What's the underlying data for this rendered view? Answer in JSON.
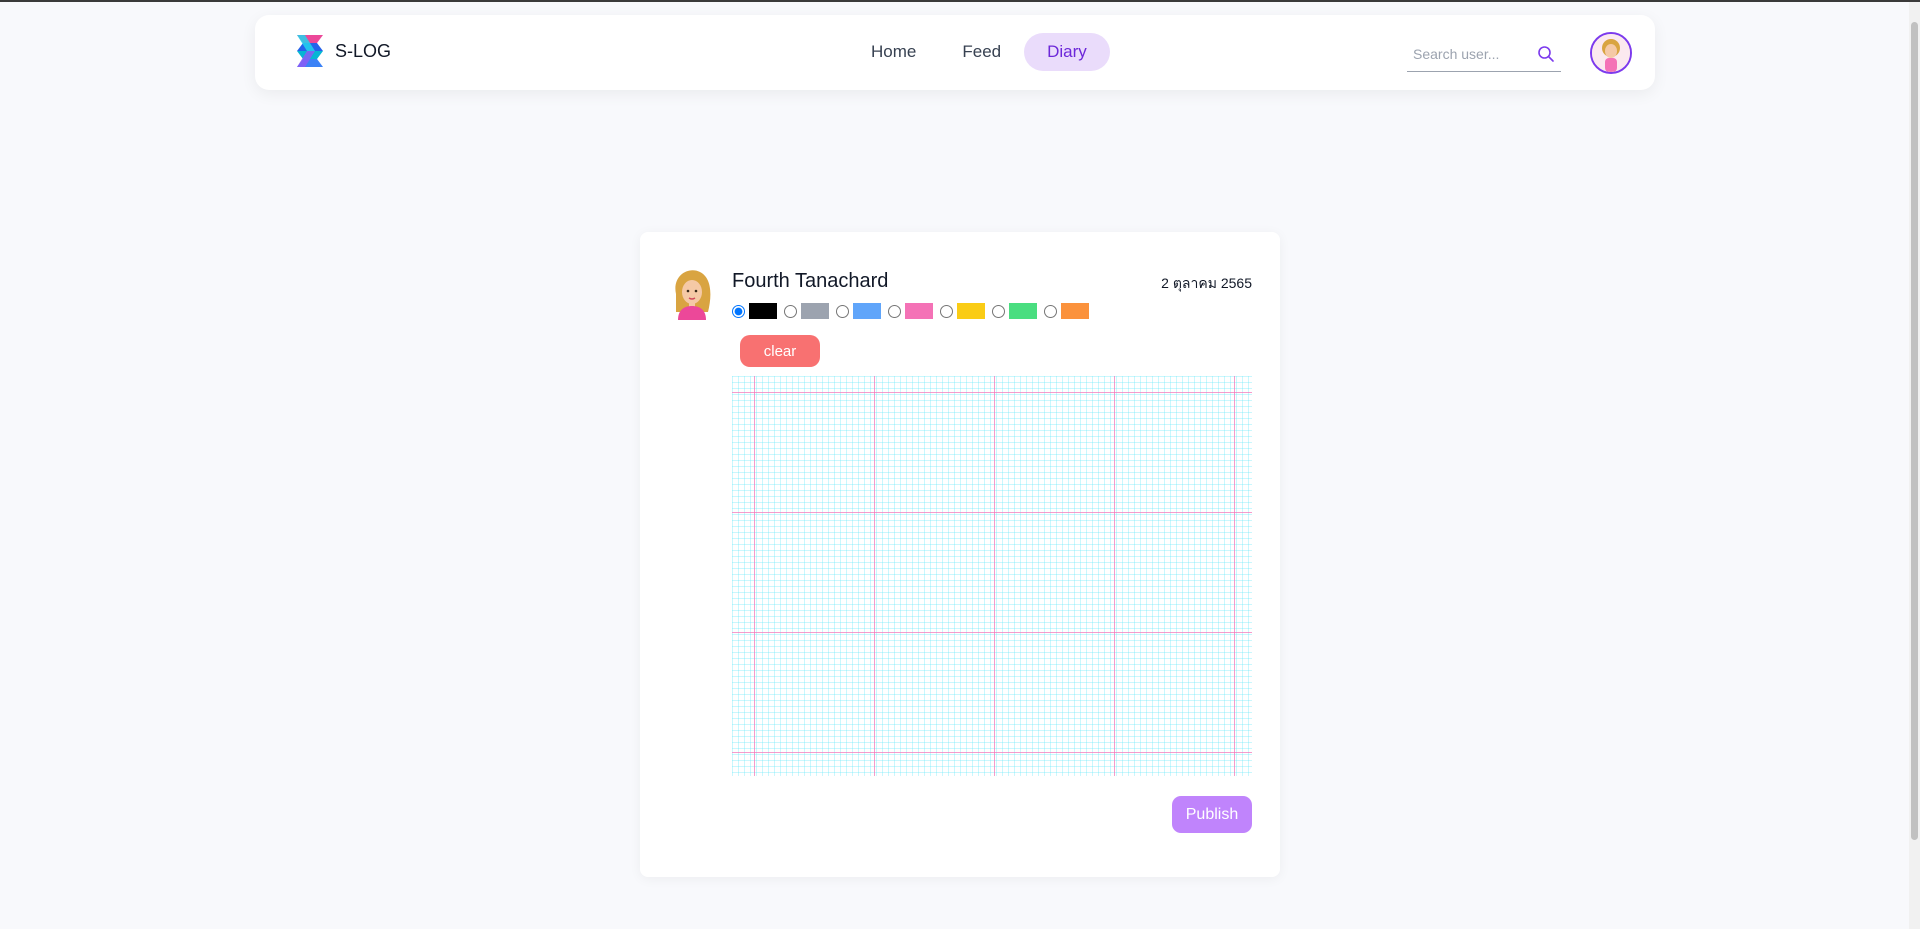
{
  "brand": {
    "name": "S-LOG"
  },
  "nav": {
    "items": [
      {
        "label": "Home",
        "active": false
      },
      {
        "label": "Feed",
        "active": false
      },
      {
        "label": "Diary",
        "active": true
      }
    ]
  },
  "search": {
    "placeholder": "Search user...",
    "value": "",
    "icon": "search-icon"
  },
  "user": {
    "avatar": "avatar-icon"
  },
  "diary": {
    "author": "Fourth Tanachard",
    "date": "2 ตุลาคม 2565",
    "selected_color": "#000000",
    "colors": [
      "#000000",
      "#9ca3af",
      "#60a5fa",
      "#f472b6",
      "#facc15",
      "#4ade80",
      "#fb923c"
    ],
    "clear_label": "clear",
    "publish_label": "Publish"
  },
  "theme": {
    "accent": "#7c3aed",
    "clear_button": "#f87171",
    "publish_button": "#c084fc"
  }
}
